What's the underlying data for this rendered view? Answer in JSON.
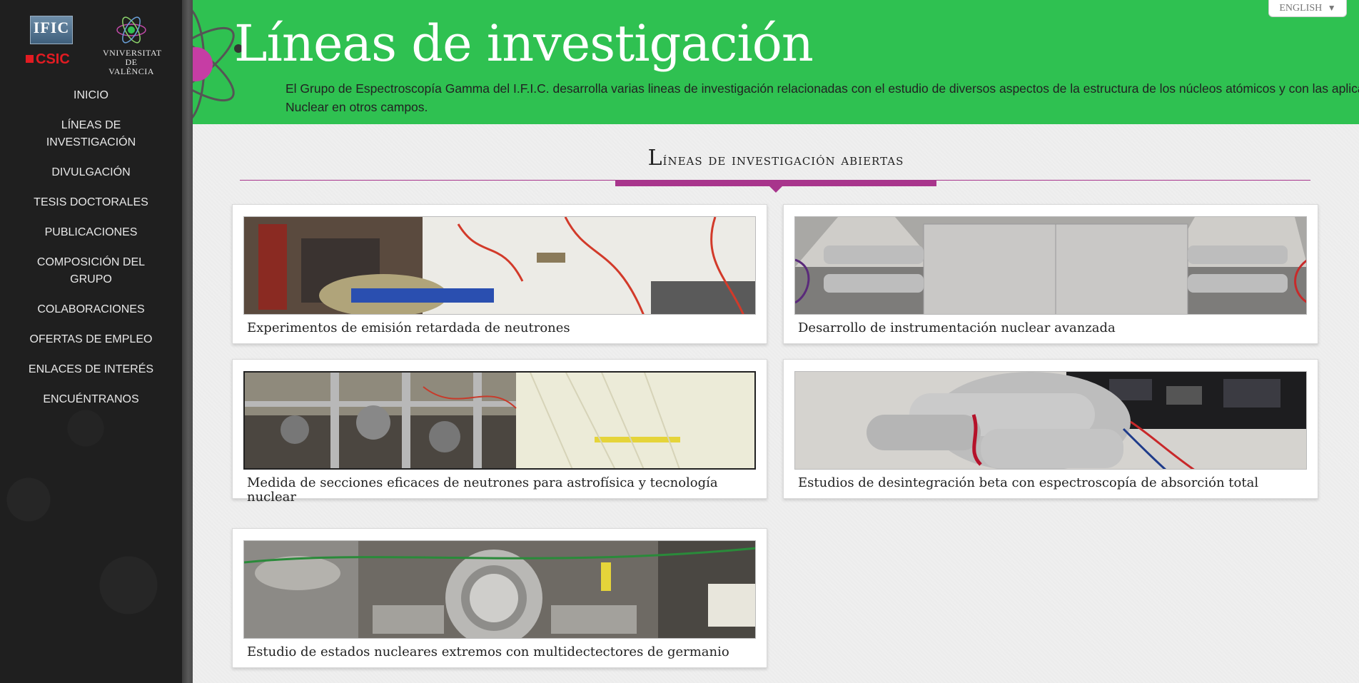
{
  "sidebar": {
    "logos": {
      "ific": "IFIC",
      "csic": "CSIC",
      "uv": "VNIVERSITAT DE VALÈNCIA"
    },
    "nav": [
      {
        "label": "INICIO"
      },
      {
        "label": "LÍNEAS DE INVESTIGACIÓN"
      },
      {
        "label": "DIVULGACIÓN"
      },
      {
        "label": "TESIS DOCTORALES"
      },
      {
        "label": "PUBLICACIONES"
      },
      {
        "label": "COMPOSICIÓN DEL GRUPO"
      },
      {
        "label": "COLABORACIONES"
      },
      {
        "label": "OFERTAS DE EMPLEO"
      },
      {
        "label": "ENLACES DE INTERÉS"
      },
      {
        "label": "ENCUÉNTRANOS"
      }
    ]
  },
  "header": {
    "title": "Líneas de investigación",
    "intro": "El Grupo de Espectroscopía Gamma del I.F.I.C. desarrolla varias lineas de investigación relacionadas con el estudio de diversos aspectos de la estructura de los núcleos atómicos y con las aplicaciones de la Física Nuclear en otros campos.",
    "language_button": "ENGLISH",
    "language_icon": "chevron-down-icon"
  },
  "main": {
    "section_title_initial": "L",
    "section_title_rest": "íneas de investigación abiertas",
    "cards": [
      {
        "caption": "Experimentos de emisión retardada de neutrones"
      },
      {
        "caption": "Desarrollo de instrumentación nuclear avanzada"
      },
      {
        "caption": "Medida de secciones eficaces de neutrones para astrofísica y tecnología nuclear"
      },
      {
        "caption": "Estudios de desintegración beta con espectroscopía de absorción total"
      },
      {
        "caption": "Estudio de estados nucleares extremos con multidectectores de germanio"
      }
    ]
  },
  "colors": {
    "header_green": "#2fc151",
    "accent_magenta": "#a8358c",
    "sidebar_dark": "#1f1f1f"
  }
}
